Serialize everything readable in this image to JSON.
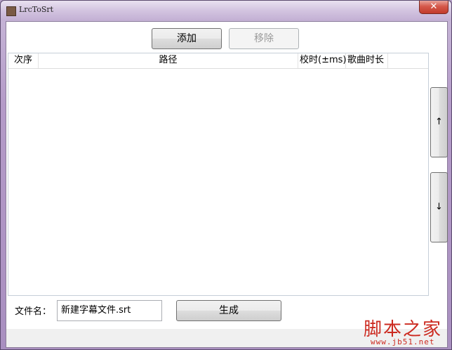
{
  "window": {
    "title": "LrcToSrt",
    "close_label": "✕"
  },
  "toolbar": {
    "add_label": "添加",
    "remove_label": "移除"
  },
  "grid": {
    "columns": [
      "次序",
      "路径",
      "校时(±ms)",
      "歌曲时长"
    ],
    "rows": []
  },
  "side_buttons": {
    "up_label": "↑",
    "down_label": "↓"
  },
  "footer": {
    "filename_label": "文件名：",
    "filename_value": "新建字幕文件.srt",
    "generate_label": "生成"
  },
  "watermark": {
    "main": "脚本之家",
    "sub": "www.jb51.net"
  },
  "colors": {
    "window_frame": "#b49bc8",
    "close_button": "#d5584a",
    "watermark": "#cc2a20"
  }
}
